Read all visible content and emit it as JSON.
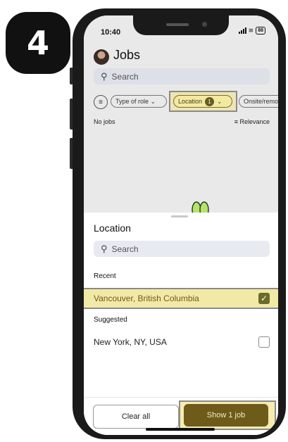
{
  "step": "4",
  "status_bar": {
    "time": "10:40",
    "battery": "88"
  },
  "header": {
    "title": "Jobs",
    "search_placeholder": "Search"
  },
  "filters": {
    "type_of_role": "Type of role",
    "location": "Location",
    "location_count": "1",
    "onsite": "Onsite/remot"
  },
  "results": {
    "count_text": "No jobs",
    "sort": "Relevance"
  },
  "sheet": {
    "title": "Location",
    "search_placeholder": "Search",
    "recent_heading": "Recent",
    "recent": [
      {
        "label": "Vancouver, British Columbia",
        "checked": true
      }
    ],
    "suggested_heading": "Suggested",
    "suggested": [
      {
        "label": "New York, NY, USA",
        "checked": false
      }
    ],
    "clear_label": "Clear all",
    "show_label": "Show 1 job"
  },
  "colors": {
    "accent": "#6e5b1a",
    "highlight": "#f3e9a6"
  },
  "icons": [
    "search-icon",
    "filter-sliders-icon",
    "chevron-down-icon",
    "sort-icon",
    "checkmark-icon",
    "signal-icon",
    "wifi-icon",
    "battery-icon"
  ]
}
